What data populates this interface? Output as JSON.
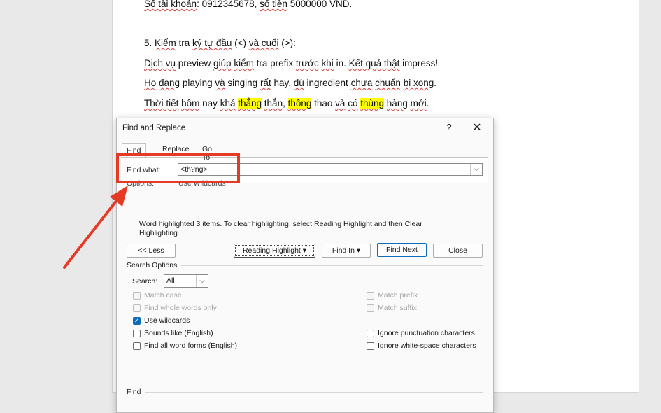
{
  "document": {
    "lines": [
      [
        {
          "t": "Số tài khoản",
          "sq": true
        },
        {
          "t": ": 0912345678, "
        },
        {
          "t": "số tiền",
          "sq": true
        },
        {
          "t": " 5000000 VND."
        }
      ],
      [
        {
          "t": "5. "
        },
        {
          "t": "Kiểm",
          "sq": true
        },
        {
          "t": " tra "
        },
        {
          "t": "ký tự đầu",
          "sq": true
        },
        {
          "t": " (<) "
        },
        {
          "t": "và cuối",
          "sq": true
        },
        {
          "t": " (>):"
        }
      ],
      [
        {
          "t": "Dịch vụ",
          "sq": true
        },
        {
          "t": " preview "
        },
        {
          "t": "giúp",
          "sq": true
        },
        {
          "t": " "
        },
        {
          "t": "kiểm",
          "sq": true
        },
        {
          "t": " tra prefix "
        },
        {
          "t": "trước",
          "sq": true
        },
        {
          "t": " "
        },
        {
          "t": "khi",
          "sq": true
        },
        {
          "t": " in. "
        },
        {
          "t": "Kết quả thật",
          "sq": true
        },
        {
          "t": " impress!"
        }
      ],
      [
        {
          "t": "Họ",
          "sq": true
        },
        {
          "t": " "
        },
        {
          "t": "đang",
          "sq": true
        },
        {
          "t": " playing "
        },
        {
          "t": "và",
          "sq": true
        },
        {
          "t": " singing "
        },
        {
          "t": "rất",
          "sq": true
        },
        {
          "t": " hay, "
        },
        {
          "t": "dù",
          "sq": true
        },
        {
          "t": " ingredient "
        },
        {
          "t": "chưa",
          "sq": true
        },
        {
          "t": " "
        },
        {
          "t": "chuẩn",
          "sq": true
        },
        {
          "t": " "
        },
        {
          "t": "bị xong",
          "sq": true
        },
        {
          "t": "."
        }
      ],
      [
        {
          "t": "Thời tiết",
          "sq": true
        },
        {
          "t": " "
        },
        {
          "t": "hôm",
          "sq": true
        },
        {
          "t": " nay "
        },
        {
          "t": "khá",
          "sq": true
        },
        {
          "t": " "
        },
        {
          "t": "thẳng",
          "sq": true,
          "hl": true
        },
        {
          "t": " "
        },
        {
          "t": "thắn",
          "sq": true
        },
        {
          "t": ", "
        },
        {
          "t": "thông",
          "sq": true,
          "hl": true
        },
        {
          "t": " thao "
        },
        {
          "t": "và",
          "sq": true
        },
        {
          "t": " "
        },
        {
          "t": "có",
          "sq": true
        },
        {
          "t": " "
        },
        {
          "t": "thùng",
          "sq": true,
          "hl": true
        },
        {
          "t": " "
        },
        {
          "t": "hàng",
          "sq": true
        },
        {
          "t": " "
        },
        {
          "t": "mới",
          "sq": true
        },
        {
          "t": "."
        }
      ]
    ]
  },
  "dialog": {
    "title": "Find and Replace",
    "help": "?",
    "close": "✕",
    "tabs": [
      "Find",
      "Replace",
      "Go To"
    ],
    "find_what_label": "Find what:",
    "find_what_value": "<th?ng>",
    "options_label": "Options:",
    "options_value": "Use Wildcards",
    "message": "Word highlighted 3 items. To clear highlighting, select Reading Highlight and then Clear Highlighting.",
    "buttons": {
      "less": "<< Less",
      "reading_highlight": "Reading Highlight ▾",
      "find_in": "Find In ▾",
      "find_next": "Find Next",
      "close": "Close"
    },
    "search_options_title": "Search Options",
    "search_label": "Search:",
    "search_value": "All",
    "checkboxes_left": [
      {
        "label": "Match case",
        "checked": false,
        "disabled": true
      },
      {
        "label": "Find whole words only",
        "checked": false,
        "disabled": true
      },
      {
        "label": "Use wildcards",
        "checked": true,
        "disabled": false
      },
      {
        "label": "Sounds like (English)",
        "checked": false,
        "disabled": false
      },
      {
        "label": "Find all word forms (English)",
        "checked": false,
        "disabled": false
      }
    ],
    "checkboxes_right": [
      {
        "label": "Match prefix",
        "checked": false,
        "disabled": true
      },
      {
        "label": "Match suffix",
        "checked": false,
        "disabled": true
      },
      {
        "label": "Ignore punctuation characters",
        "checked": false,
        "disabled": false
      },
      {
        "label": "Ignore white-space characters",
        "checked": false,
        "disabled": false
      }
    ],
    "find_section_title": "Find"
  },
  "colors": {
    "annotation": "#e53a25",
    "highlight": "#ffff00",
    "accent": "#0f6cbd"
  }
}
